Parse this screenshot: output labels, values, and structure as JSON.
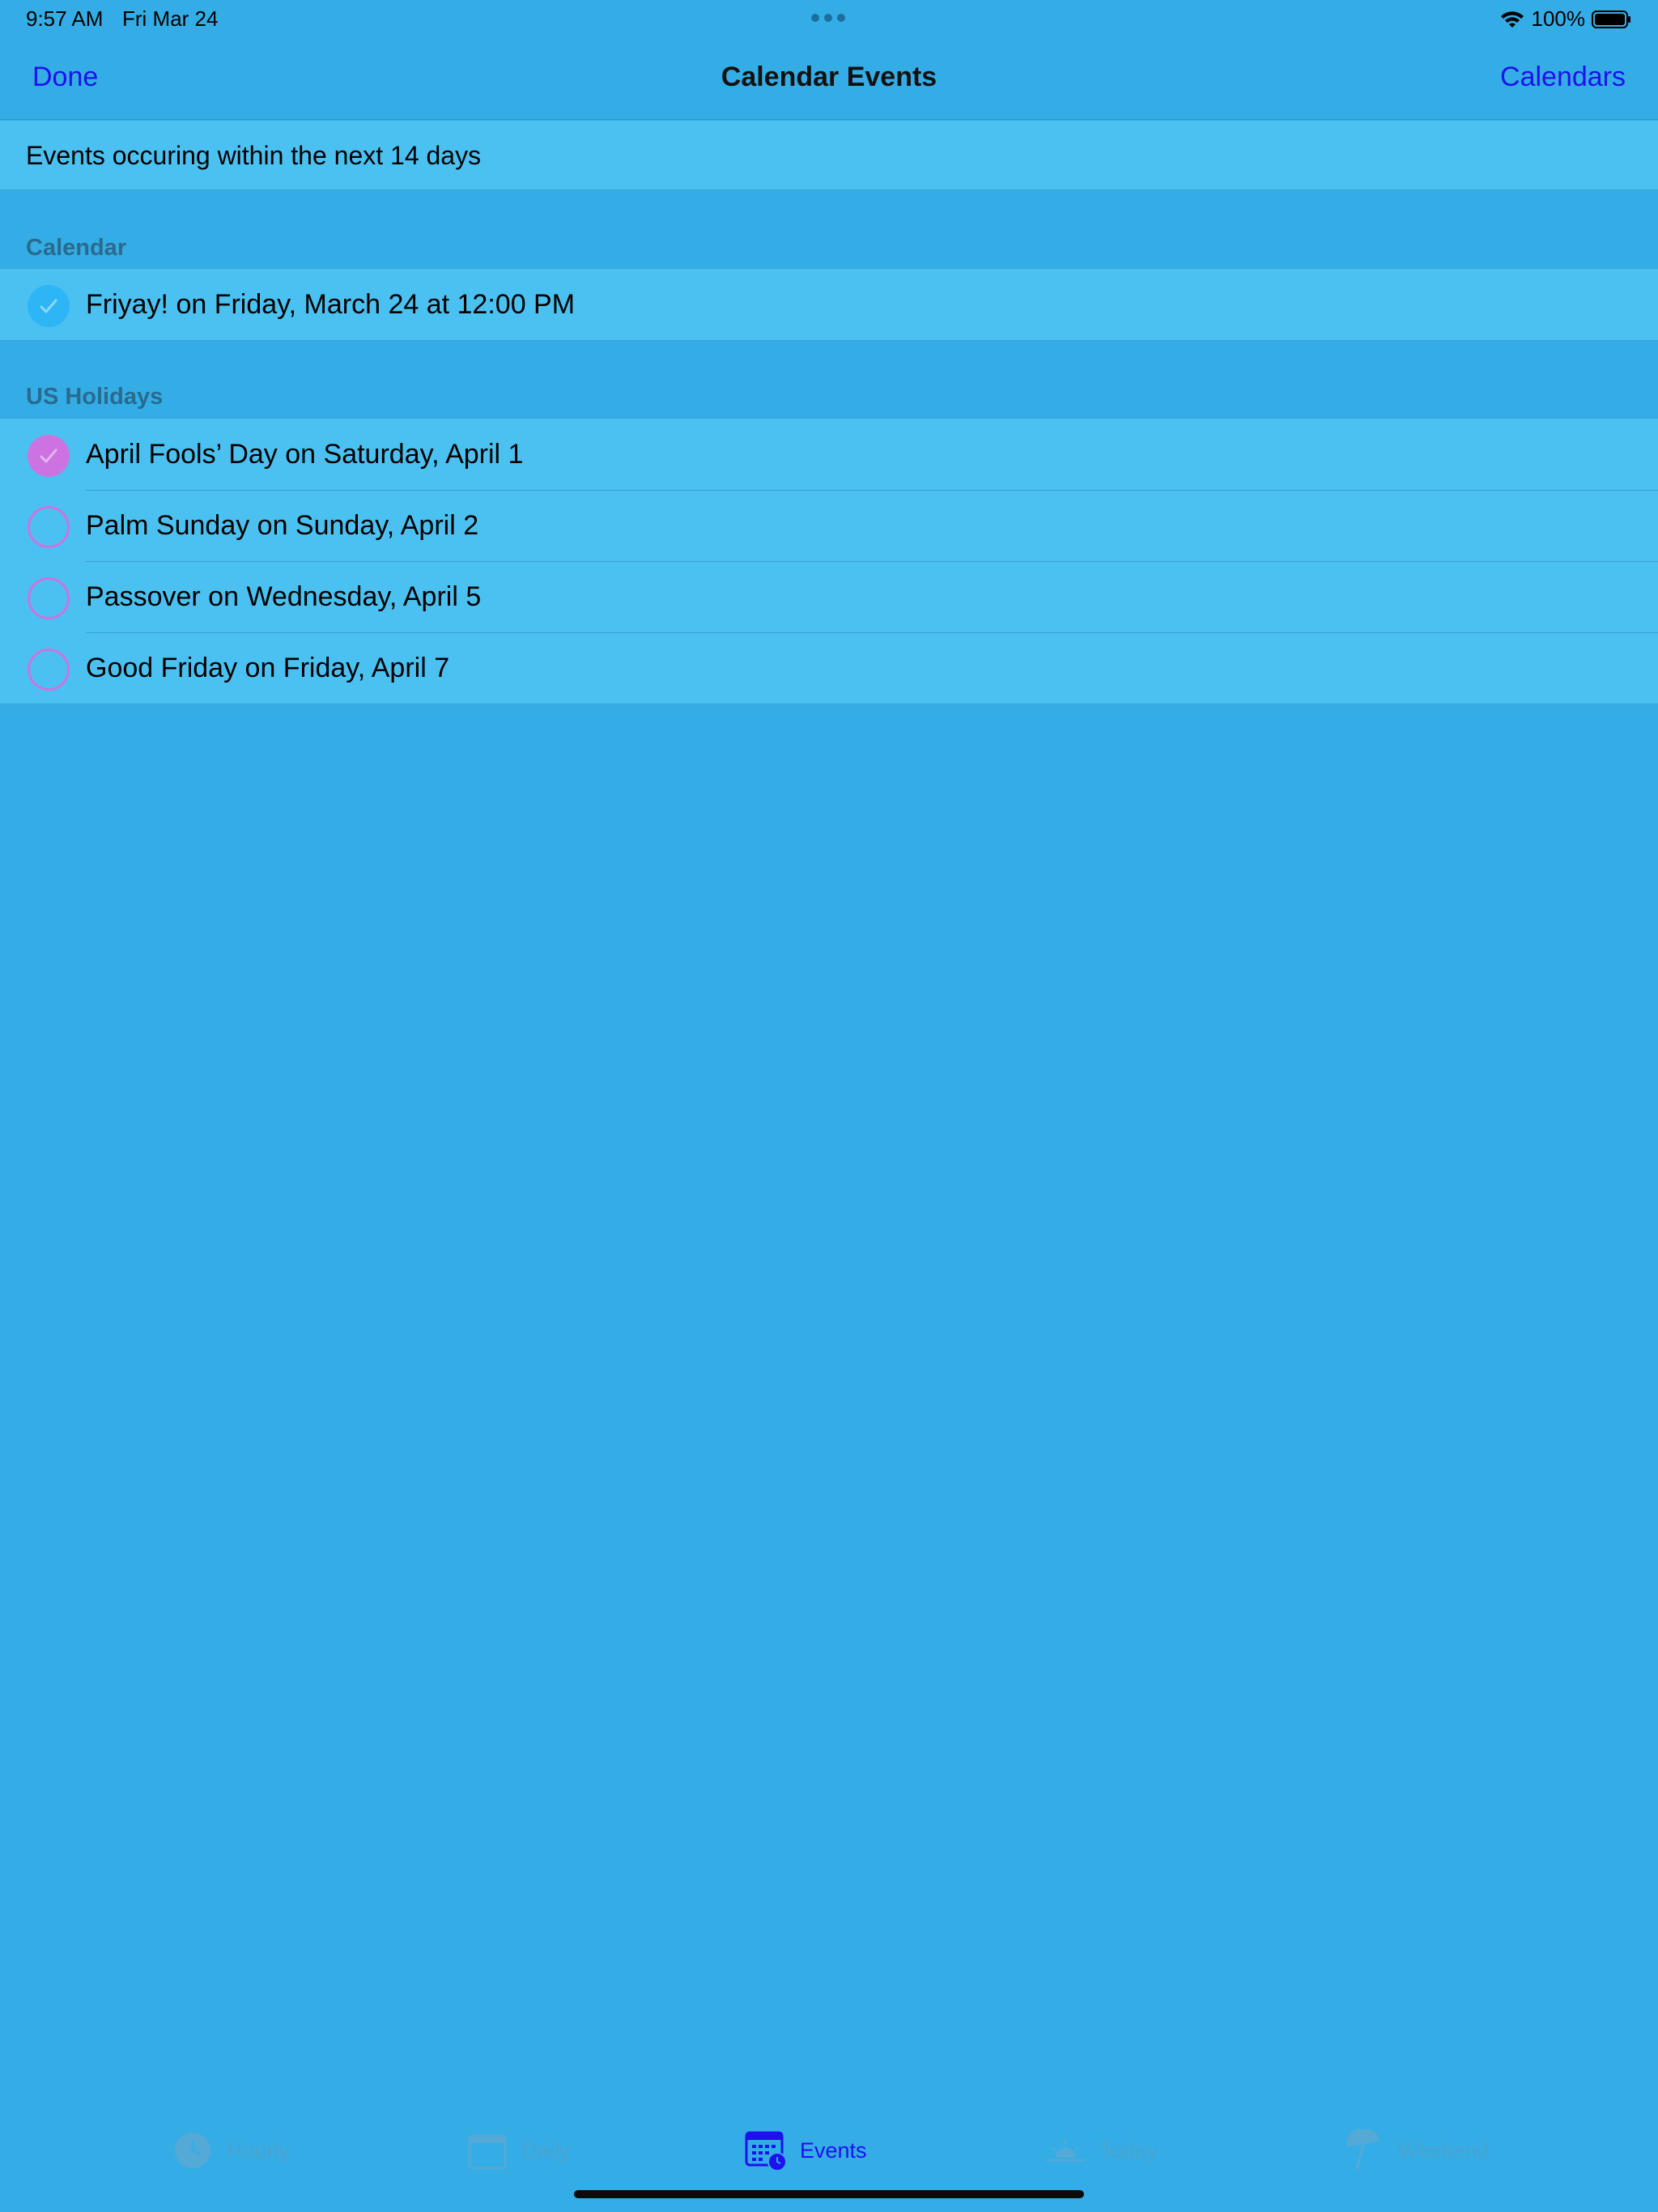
{
  "status_bar": {
    "time": "9:57 AM",
    "date": "Fri Mar 24",
    "battery": "100%"
  },
  "nav": {
    "left_label": "Done",
    "title": "Calendar Events",
    "right_label": "Calendars"
  },
  "info": "Events occuring within the next 14 days",
  "sections": [
    {
      "header": "Calendar",
      "color": "#2eb5f5",
      "items": [
        {
          "label": "Friyay! on Friday, March 24 at 12:00 PM",
          "checked": true
        }
      ]
    },
    {
      "header": "US Holidays",
      "color": "#cc73e1",
      "items": [
        {
          "label": "April Fools’ Day on Saturday, April 1",
          "checked": true
        },
        {
          "label": "Palm Sunday on Sunday, April 2",
          "checked": false
        },
        {
          "label": "Passover on Wednesday, April 5",
          "checked": false
        },
        {
          "label": "Good Friday on Friday, April 7",
          "checked": false
        }
      ]
    }
  ],
  "tabs": [
    {
      "label": "Hourly",
      "icon": "clock-icon",
      "active": false
    },
    {
      "label": "Daily",
      "icon": "calendar-icon",
      "active": false
    },
    {
      "label": "Events",
      "icon": "calendar-clock-icon",
      "active": true
    },
    {
      "label": "Today",
      "icon": "sunrise-icon",
      "active": false
    },
    {
      "label": "Weekend",
      "icon": "beach-umbrella-icon",
      "active": false
    }
  ],
  "colors": {
    "background": "#34ade6",
    "accent": "#1e10f0",
    "row_background": "#4bc1f2"
  }
}
